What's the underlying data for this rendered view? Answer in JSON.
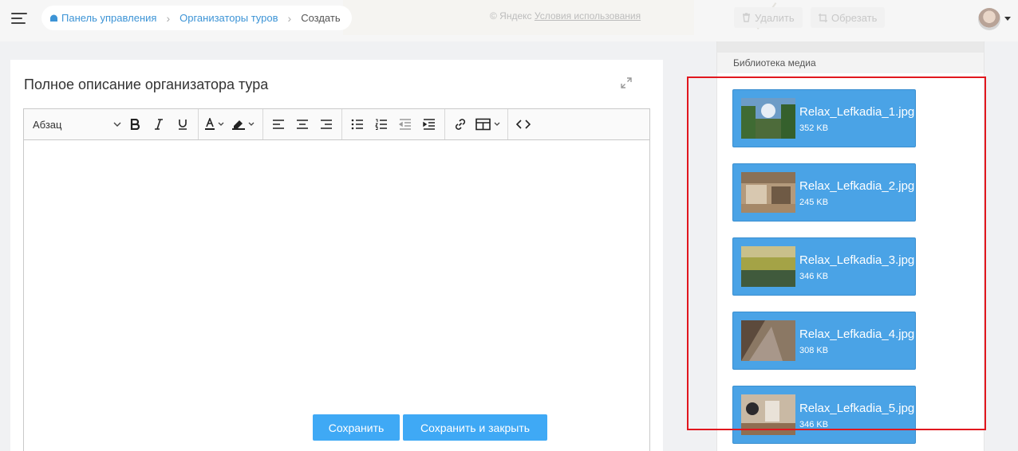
{
  "header": {
    "map_note_prefix": "© Яндекс",
    "map_note_link": "Условия использования",
    "breadcrumb": {
      "home": "Панель управления",
      "section": "Организаторы туров",
      "current": "Создать"
    },
    "ghost_buttons": {
      "delete": "Удалить",
      "crop": "Обрезать"
    }
  },
  "editor": {
    "title": "Полное описание организатора тура",
    "paragraph_style": "Абзац",
    "icons": [
      "bold-icon",
      "italic-icon",
      "underline-icon",
      "font-color-icon",
      "highlight-icon",
      "align-left-icon",
      "align-center-icon",
      "align-right-icon",
      "bulleted-list-icon",
      "numbered-list-icon",
      "outdent-icon",
      "indent-icon",
      "link-icon",
      "table-icon",
      "source-code-icon"
    ],
    "content": ""
  },
  "actions": {
    "save": "Сохранить",
    "save_close": "Сохранить и закрыть"
  },
  "media": {
    "title": "Библиотека медиа",
    "items": [
      {
        "name": "Relax_Lefkadia_1.jpg",
        "size": "352 KB"
      },
      {
        "name": "Relax_Lefkadia_2.jpg",
        "size": "245 KB"
      },
      {
        "name": "Relax_Lefkadia_3.jpg",
        "size": "346 KB"
      },
      {
        "name": "Relax_Lefkadia_4.jpg",
        "size": "308 KB"
      },
      {
        "name": "Relax_Lefkadia_5.jpg",
        "size": "346 KB"
      }
    ]
  },
  "colors": {
    "accent": "#3fa9f5",
    "media_item": "#4aa3e6",
    "highlight": "#e1171e",
    "link": "#3d94d6"
  }
}
